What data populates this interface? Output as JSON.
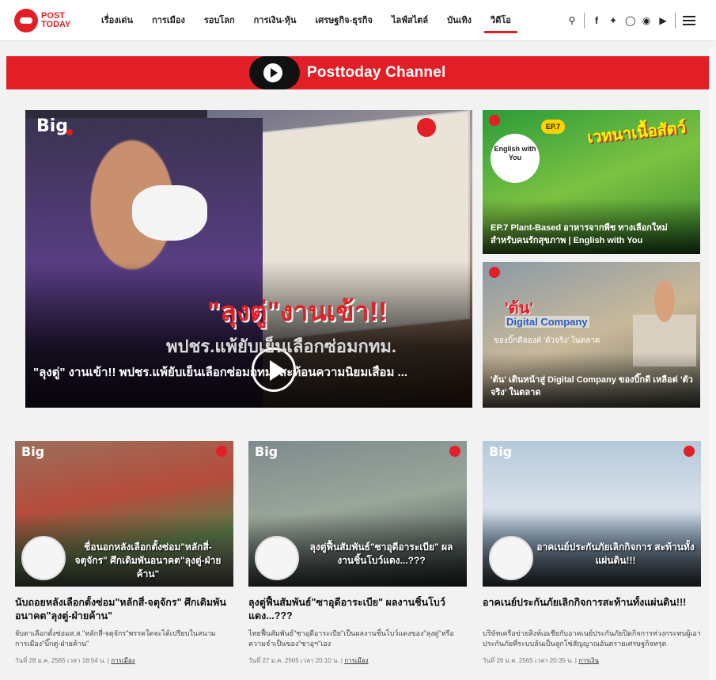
{
  "header": {
    "logo_line1": "POST",
    "logo_line2": "TODAY",
    "nav": [
      {
        "label": "เรื่องเด่น",
        "active": false
      },
      {
        "label": "การเมือง",
        "active": false
      },
      {
        "label": "รอบโลก",
        "active": false
      },
      {
        "label": "การเงิน-หุ้น",
        "active": false
      },
      {
        "label": "เศรษฐกิจ-ธุรกิจ",
        "active": false
      },
      {
        "label": "ไลฟ์สไตล์",
        "active": false
      },
      {
        "label": "บันเทิง",
        "active": false
      },
      {
        "label": "วิดีโอ",
        "active": true
      }
    ],
    "icons": [
      "search-icon",
      "facebook-icon",
      "twitter-icon",
      "instagram-icon",
      "line-icon",
      "youtube-icon",
      "menu-icon"
    ]
  },
  "channel": {
    "title": "Posttoday Channel"
  },
  "hero": {
    "overlay_title": "\"ลุงตู่\"งานเข้า!!",
    "overlay_sub": "พปชร.แพ้ยับเย็นเลือกซ่อมกทม.",
    "caption": "\"ลุงตู่\" งานเข้า!! พปชร.แพ้ยับเย็นเลือกซ่อมกทม. สะท้อนความนิยมเสื่อม ...",
    "big_label": "Big"
  },
  "side_cards": [
    {
      "art_title": "เวทนาเนื้อสัตว์",
      "ep_badge": "EP.7",
      "show_badge": "English with You",
      "caption": "EP.7 Plant-Based อาหารจากพืช ทางเลือกใหม่ สำหรับคนรักสุขภาพ | English with You"
    },
    {
      "art_title": "'ต้น'",
      "art_sub": "Digital Company",
      "art_line": "ของบิ๊กดีลองค์ 'ตัวจริง' ในตลาด",
      "caption": "'ต้น' เดินหน้าสู่ Digital Company ของบิ๊กดี เหลือต่ 'ตัวจริง' ในตลาด"
    }
  ],
  "articles": [
    {
      "overlay": "ชื่อนอกหลังเลือกตั้งซ่อม\"หลักสี่-จตุจักร\" ศึกเดิมพันอนาคต\"ลุงตู่-ฝ่ายค้าน\"",
      "title": "นับถอยหลังเลือกตั้งซ่อม\"หลักสี่-จตุจักร\" ศึกเดิมพันอนาคต\"ลุงตู่-ฝ่ายค้าน\"",
      "summary": "จับตาเลือกตั้งซ่อมส.ส.\"หลักสี่-จตุจักร\"พรรคใดจะได้เปรียบในสนามการเมือง\"บิ๊กตู่-ฝ่ายค้าน\"",
      "date": "วันที่ 28 ม.ค. 2565 เวลา 18:54 น.",
      "category": "การเมือง"
    },
    {
      "overlay": "ลุงตู่ฟื้นสัมพันธ์\"ซาอุดีอาระเบีย\" ผลงานชิ้นโบว์แดง...???",
      "title": "ลุงตู่ฟื้นสัมพันธ์\"ซาอุดีอาระเบีย\" ผลงานชิ้นโบว์แดง...???",
      "summary": "ไทยฟื้นสัมพันธ์\"ซาอุดีอาระเบีย\"เป็นผลงานชิ้นโบว์แดงของ\"ลุงตู่\"หรือความจำเป็นของ\"ซาอุฯ\"เอง",
      "date": "วันที่ 27 ม.ค. 2565 เวลา 20:10 น.",
      "category": "การเมือง"
    },
    {
      "overlay": "อาคเนย์ประกันภัยเลิกกิจการ สะท้านทั้งแผ่นดิน!!!",
      "title": "อาคเนย์ประกันภัยเลิกกิจการสะท้านทั้งแผ่นดิน!!!",
      "summary": "บริษัทเครือข่ายสิงห์เอเชียกับอาคเนย์ประกันภัยปิดกิจการห่วงกระทบผู้เอาประกันภัยที่ระบบล้นเป็นลูกโซ่สัญญาณอันตรายเศรษฐกิจทรุด",
      "date": "วันที่ 26 ม.ค. 2565 เวลา 20:35 น.",
      "category": "การเงิน"
    }
  ],
  "colors": {
    "brand_red": "#e21f26",
    "text_dark": "#111111"
  }
}
